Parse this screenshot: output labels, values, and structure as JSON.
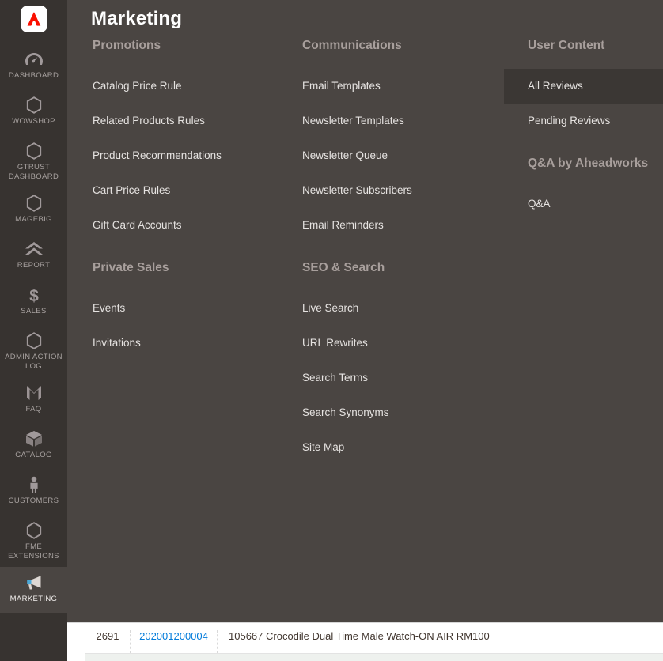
{
  "rail": {
    "logo_name": "adobe-commerce-logo",
    "logo_color": "#fa0f00",
    "items": [
      {
        "label": "Dashboard",
        "icon": "gauge-icon",
        "key": "dashboard",
        "active": false
      },
      {
        "label": "Wowshop",
        "icon": "hexagon-icon",
        "key": "wowshop",
        "active": false
      },
      {
        "label": "Gtrust Dashboard",
        "icon": "hexagon-icon",
        "key": "gtrust-dashboard",
        "active": false
      },
      {
        "label": "Magebig",
        "icon": "hexagon-icon",
        "key": "magebig",
        "active": false
      },
      {
        "label": "Report",
        "icon": "chevron-stack-icon",
        "key": "report",
        "active": false
      },
      {
        "label": "Sales",
        "icon": "dollar-icon",
        "key": "sales",
        "active": false
      },
      {
        "label": "Admin Action Log",
        "icon": "hexagon-icon",
        "key": "admin-action-log",
        "active": false
      },
      {
        "label": "FAQ",
        "icon": "m-letter-icon",
        "key": "faq",
        "active": false
      },
      {
        "label": "Catalog",
        "icon": "box-icon",
        "key": "catalog",
        "active": false
      },
      {
        "label": "Customers",
        "icon": "person-icon",
        "key": "customers",
        "active": false
      },
      {
        "label": "FME Extensions",
        "icon": "hexagon-icon",
        "key": "fme-extensions",
        "active": false
      },
      {
        "label": "Marketing",
        "icon": "megaphone-icon",
        "key": "marketing",
        "active": true
      }
    ]
  },
  "panel": {
    "title": "Marketing",
    "columns": [
      {
        "groups": [
          {
            "title": "Promotions",
            "items": [
              {
                "label": "Catalog Price Rule",
                "selected": false
              },
              {
                "label": "Related Products Rules",
                "selected": false
              },
              {
                "label": "Product Recommendations",
                "selected": false
              },
              {
                "label": "Cart Price Rules",
                "selected": false
              },
              {
                "label": "Gift Card Accounts",
                "selected": false
              }
            ]
          },
          {
            "title": "Private Sales",
            "items": [
              {
                "label": "Events",
                "selected": false
              },
              {
                "label": "Invitations",
                "selected": false
              }
            ]
          }
        ]
      },
      {
        "groups": [
          {
            "title": "Communications",
            "items": [
              {
                "label": "Email Templates",
                "selected": false
              },
              {
                "label": "Newsletter Templates",
                "selected": false
              },
              {
                "label": "Newsletter Queue",
                "selected": false
              },
              {
                "label": "Newsletter Subscribers",
                "selected": false
              },
              {
                "label": "Email Reminders",
                "selected": false
              }
            ]
          },
          {
            "title": "SEO & Search",
            "items": [
              {
                "label": "Live Search",
                "selected": false
              },
              {
                "label": "URL Rewrites",
                "selected": false
              },
              {
                "label": "Search Terms",
                "selected": false
              },
              {
                "label": "Search Synonyms",
                "selected": false
              },
              {
                "label": "Site Map",
                "selected": false
              }
            ]
          }
        ]
      },
      {
        "groups": [
          {
            "title": "User Content",
            "items": [
              {
                "label": "All Reviews",
                "selected": true
              },
              {
                "label": "Pending Reviews",
                "selected": false
              }
            ]
          },
          {
            "title": "Q&A by Aheadworks",
            "items": [
              {
                "label": "Q&A",
                "selected": false
              }
            ]
          }
        ]
      }
    ]
  },
  "grid": {
    "row": {
      "id": "2691",
      "sku": "202001200004",
      "name": "105667 Crocodile Dual Time Male Watch-ON AIR RM100"
    },
    "sku_color": "#007bdb"
  }
}
